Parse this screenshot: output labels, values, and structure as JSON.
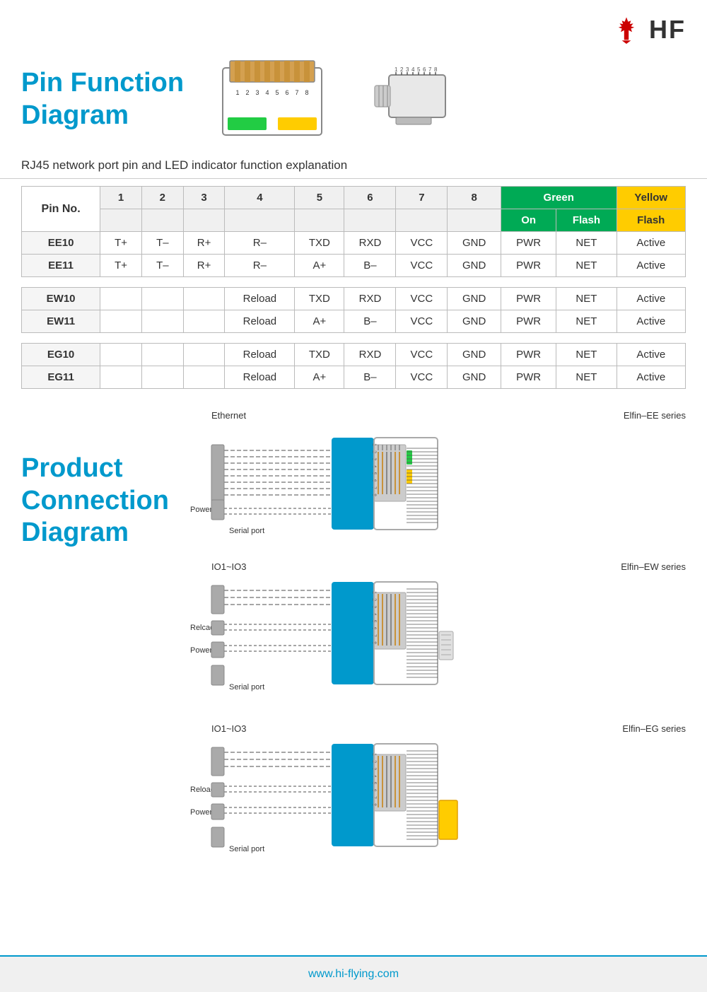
{
  "header": {
    "logo_text": "HF",
    "logo_alt": "HF Logo"
  },
  "title_section": {
    "title_line1": "Pin Function",
    "title_line2": "Diagram"
  },
  "subtitle": "RJ45 network port pin and LED indicator function explanation",
  "table": {
    "col_headers": [
      "Pin No.",
      "1",
      "2",
      "3",
      "4",
      "5",
      "6",
      "7",
      "8"
    ],
    "led_headers": {
      "green_on": "On",
      "green_flash": "Flash",
      "yellow_flash": "Flash",
      "green_label": "Green",
      "yellow_label": "Yellow"
    },
    "rows": [
      {
        "label": "EE10",
        "cols": [
          "T+",
          "T–",
          "R+",
          "R–",
          "TXD",
          "RXD",
          "VCC",
          "GND"
        ],
        "leds": [
          "PWR",
          "NET",
          "Active"
        ]
      },
      {
        "label": "EE11",
        "cols": [
          "T+",
          "T–",
          "R+",
          "R–",
          "A+",
          "B–",
          "VCC",
          "GND"
        ],
        "leds": [
          "PWR",
          "NET",
          "Active"
        ]
      },
      null,
      {
        "label": "EW10",
        "cols": [
          "",
          "",
          "",
          "Reload",
          "TXD",
          "RXD",
          "VCC",
          "GND"
        ],
        "leds": [
          "PWR",
          "NET",
          "Active"
        ]
      },
      {
        "label": "EW11",
        "cols": [
          "",
          "",
          "",
          "Reload",
          "A+",
          "B–",
          "VCC",
          "GND"
        ],
        "leds": [
          "PWR",
          "NET",
          "Active"
        ]
      },
      null,
      {
        "label": "EG10",
        "cols": [
          "",
          "",
          "",
          "Reload",
          "TXD",
          "RXD",
          "VCC",
          "GND"
        ],
        "leds": [
          "PWR",
          "NET",
          "Active"
        ]
      },
      {
        "label": "EG11",
        "cols": [
          "",
          "",
          "",
          "Reload",
          "A+",
          "B–",
          "VCC",
          "GND"
        ],
        "leds": [
          "PWR",
          "NET",
          "Active"
        ]
      }
    ]
  },
  "product_connection": {
    "title_line1": "Product",
    "title_line2": "Connection",
    "title_line3": "Diagram",
    "diagrams": [
      {
        "series": "Elfin–EE series",
        "labels": [
          "Ethernet",
          "Power",
          "Serial port"
        ],
        "color": "#0099cc"
      },
      {
        "series": "Elfin–EW series",
        "labels": [
          "IO1~IO3",
          "Relcad",
          "Power",
          "Serial port"
        ],
        "color": "#0099cc"
      },
      {
        "series": "Elfin–EG series",
        "labels": [
          "IO1~IO3",
          "Reload",
          "Power",
          "Serial port"
        ],
        "color": "#ffcc00"
      }
    ]
  },
  "footer": {
    "url": "www.hi-flying.com"
  }
}
